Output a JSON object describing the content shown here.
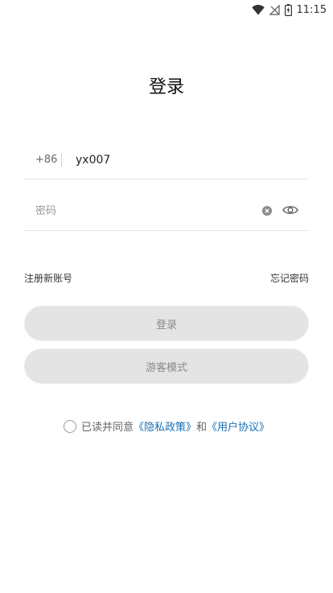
{
  "status_bar": {
    "time": "11:15",
    "icons": [
      "wifi-icon",
      "no-signal-icon",
      "battery-charging-icon"
    ]
  },
  "page": {
    "title": "登录"
  },
  "phone": {
    "country_code": "+86",
    "value": "yx007"
  },
  "password": {
    "placeholder": "密码",
    "icons": [
      "clear-icon",
      "eye-icon"
    ]
  },
  "links": {
    "register": "注册新账号",
    "forgot_password": "忘记密码"
  },
  "buttons": {
    "login": "登录",
    "guest": "游客模式"
  },
  "agreement": {
    "prefix": "已读并同意",
    "privacy_link": "《隐私政策》",
    "middle": "和",
    "user_agreement_link": "《用户协议》"
  },
  "colors": {
    "link": "#1a6fb6",
    "button_bg": "#e4e4e4",
    "button_text": "#8a8a8a"
  }
}
